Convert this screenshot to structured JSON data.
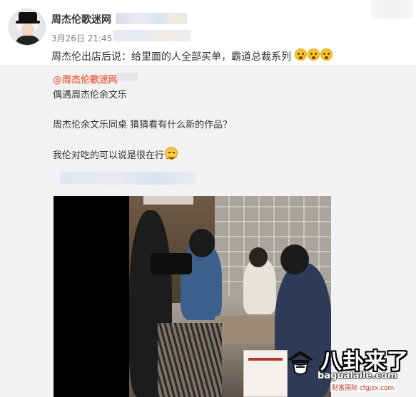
{
  "post": {
    "username": "周杰伦歌迷网",
    "timestamp": "3月26日 21:45",
    "text": "周杰伦出店后说：给里面的人全部买单，霸道总裁系列",
    "emojis": [
      "shocked-face-emoji",
      "shocked-face-emoji",
      "shocked-face-emoji"
    ]
  },
  "repost": {
    "user": "@周杰伦歌迷网",
    "lines": [
      "偶遇周杰伦余文乐",
      "周杰伦余文乐同桌 猜猜看有什么新的作品？",
      "我伦对吃的可以说是很在行了"
    ],
    "trailing_emoji": "smile-emoji"
  },
  "video": {
    "description_icon": "video-frame"
  },
  "watermark": {
    "main": "八卦来了",
    "sub": "bagualaile.com",
    "foot": "财富国际 cfgjzx.com"
  },
  "colors": {
    "link": "#eb7350",
    "repost_bg": "#f2f2f5",
    "text": "#333333",
    "meta": "#808080"
  }
}
